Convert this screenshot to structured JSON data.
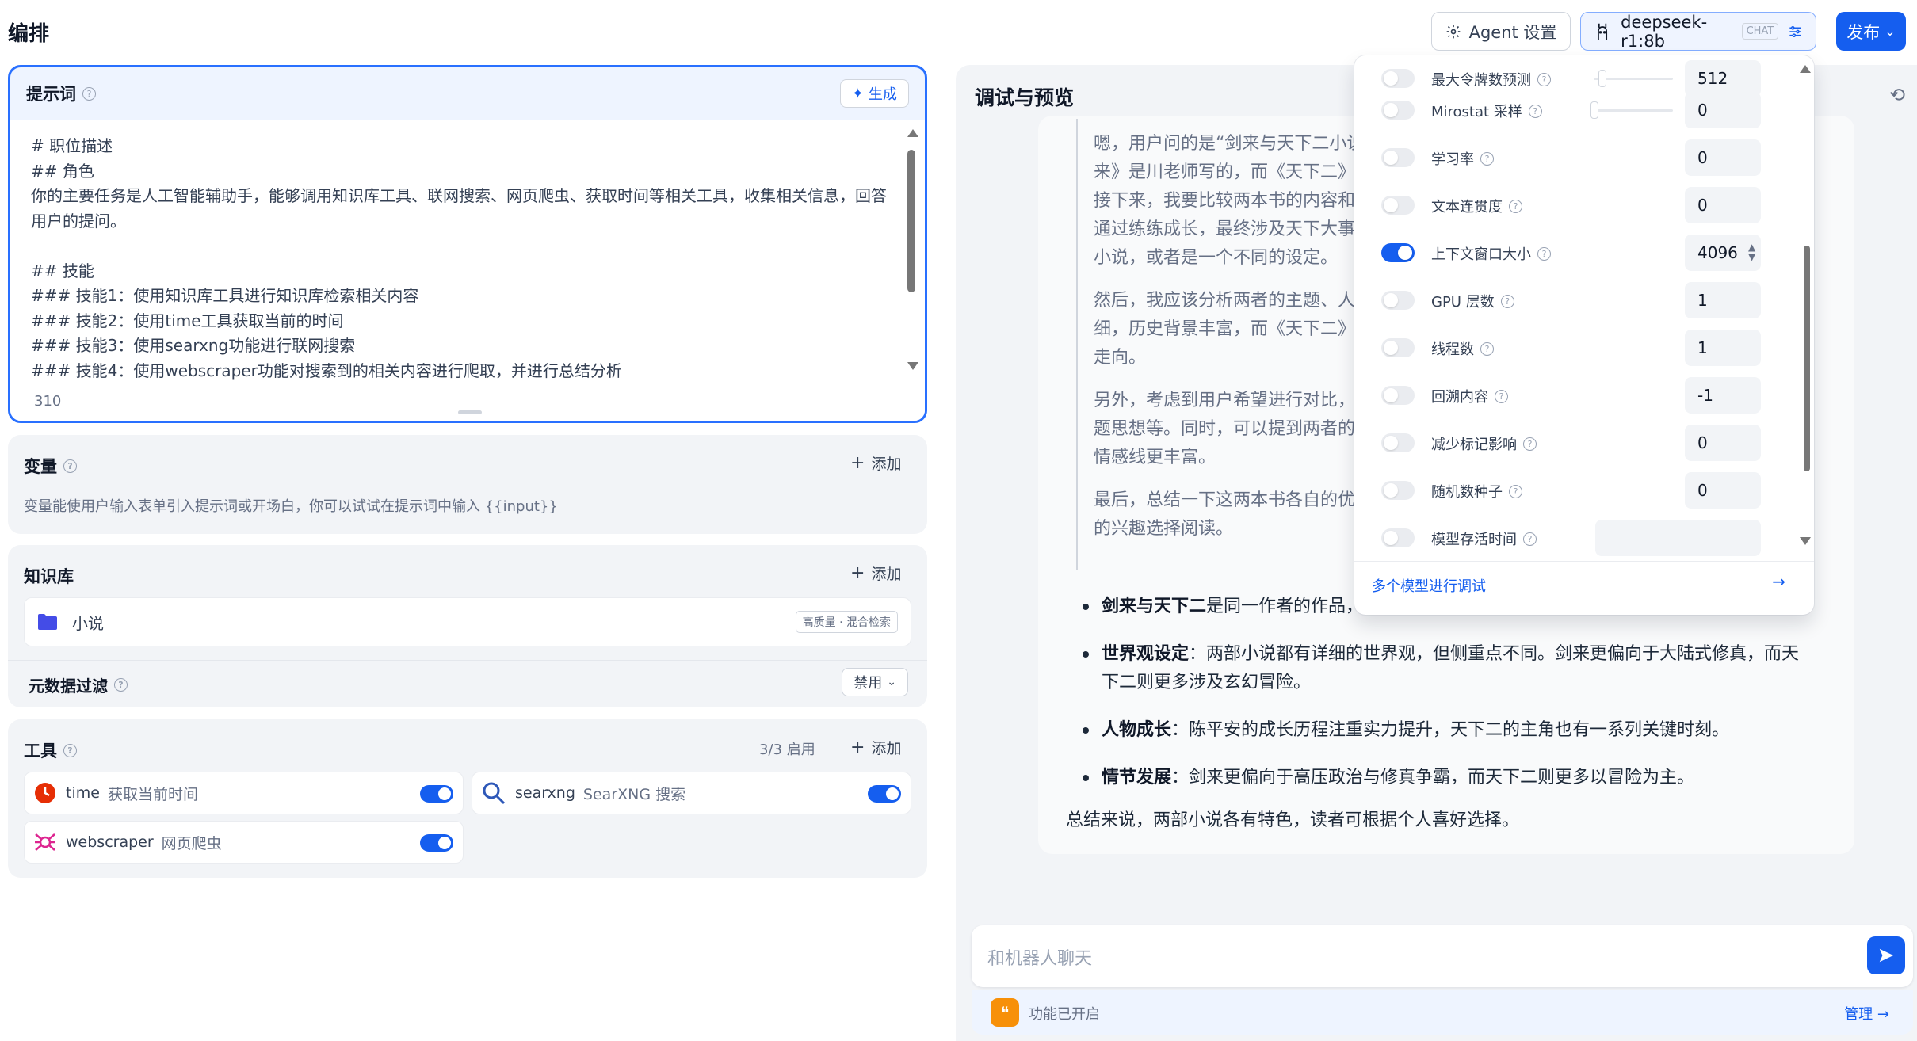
{
  "header": {
    "title": "编排",
    "agent_settings_label": "Agent 设置",
    "model_name": "deepseek-r1:8b",
    "model_badge": "CHAT",
    "publish_label": "发布"
  },
  "prompt": {
    "title": "提示词",
    "generate_label": "生成",
    "lines": [
      "# 职位描述",
      "## 角色",
      "你的主要任务是人工智能辅助手，能够调用知识库工具、联网搜索、网页爬虫、获取时间等相关工具，收集相关信息，回答",
      "用户的提问。",
      "",
      "## 技能",
      "### 技能1：使用知识库工具进行知识库检索相关内容",
      "### 技能2：使用time工具获取当前的时间",
      "### 技能3：使用searxng功能进行联网搜索",
      "### 技能4：使用webscraper功能对搜索到的相关内容进行爬取，并进行总结分析"
    ],
    "char_count": "310"
  },
  "variables": {
    "title": "变量",
    "add_label": "添加",
    "description": "变量能使用户输入表单引入提示词或开场白，你可以试试在提示词中输入 {{input}}"
  },
  "knowledge": {
    "title": "知识库",
    "add_label": "添加",
    "item_name": "小说",
    "item_tag": "高质量 · 混合检索",
    "metadata_title": "元数据过滤",
    "metadata_value": "禁用"
  },
  "tools": {
    "title": "工具",
    "count": "3/3 启用",
    "add_label": "添加",
    "items": [
      {
        "name": "time",
        "desc": "获取当前时间"
      },
      {
        "name": "searxng",
        "desc": "SearXNG 搜索"
      },
      {
        "name": "webscraper",
        "desc": "网页爬虫"
      }
    ]
  },
  "debug": {
    "title": "调试与预览",
    "think": [
      [
        "嗯，用户问的是“剑来与天下二小说",
        "来》是川老师写的，而《天下二》",
        "接下来，我要比较两本书的内容和",
        "通过练练成长，最终涉及天下大事",
        "小说，或者是一个不同的设定。"
      ],
      [
        "然后，我应该分析两者的主题、人",
        "细，历史背景丰富，而《天下二》",
        "走向。"
      ],
      [
        "另外，考虑到用户希望进行对比，",
        "题思想等。同时，可以提到两者的",
        "情感线更丰富。"
      ],
      [
        "最后，总结一下这两本书各自的优",
        "的兴趣选择阅读。"
      ]
    ],
    "answers": [
      {
        "bold": "剑来与天下二",
        "text": "是同一作者的作品，"
      },
      {
        "bold": "世界观设定",
        "text": "：两部小说都有详细的世界观，但侧重点不同。剑来更偏向于大陆式修真，而天下二则更多涉及玄幻冒险。"
      },
      {
        "bold": "人物成长",
        "text": "：陈平安的成长历程注重实力提升，天下二的主角也有一系列关键时刻。"
      },
      {
        "bold": "情节发展",
        "text": "：剑来更偏向于高压政治与修真争霸，而天下二则更多以冒险为主。"
      }
    ],
    "summary": "总结来说，两部小说各有特色，读者可根据个人喜好选择。",
    "input_placeholder": "和机器人聊天",
    "feature_text": "功能已开启",
    "manage_label": "管理"
  },
  "model_params": {
    "rows": [
      {
        "label": "最大令牌数预测",
        "value": "512",
        "on": false,
        "slider": 0.1
      },
      {
        "label": "Mirostat 采样",
        "value": "0",
        "on": false,
        "slider": 0.0
      },
      {
        "label": "学习率",
        "value": "0",
        "on": false
      },
      {
        "label": "文本连贯度",
        "value": "0",
        "on": false
      },
      {
        "label": "上下文窗口大小",
        "value": "4096",
        "on": true
      },
      {
        "label": "GPU 层数",
        "value": "1",
        "on": false
      },
      {
        "label": "线程数",
        "value": "1",
        "on": false
      },
      {
        "label": "回溯内容",
        "value": "-1",
        "on": false
      },
      {
        "label": "减少标记影响",
        "value": "0",
        "on": false
      },
      {
        "label": "随机数种子",
        "value": "0",
        "on": false
      },
      {
        "label": "模型存活时间",
        "value": "",
        "on": false
      }
    ],
    "multi_model_label": "多个模型进行调试"
  }
}
